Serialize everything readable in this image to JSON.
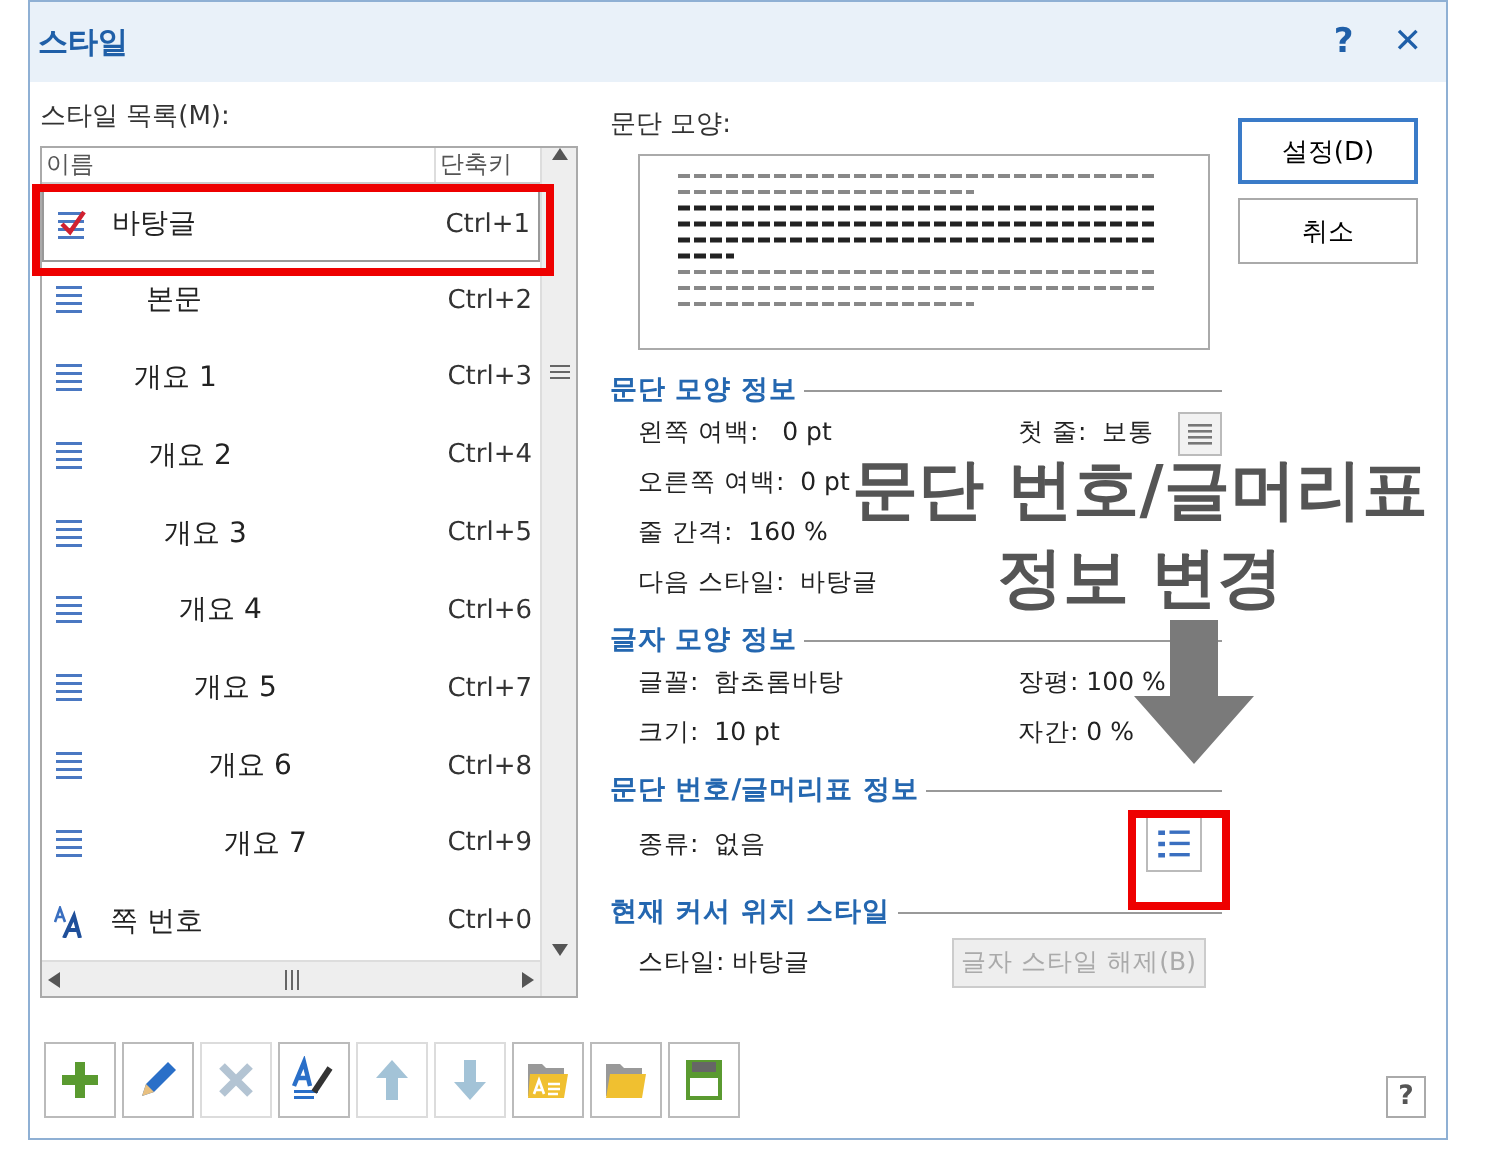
{
  "window": {
    "title": "스타일",
    "help": "?",
    "close": "✕"
  },
  "style_list": {
    "label": "스타일 목록(M):",
    "columns": [
      "이름",
      "단축키"
    ],
    "rows": [
      {
        "kind": "checked",
        "name": "바탕글",
        "shortcut": "Ctrl+1",
        "selected": true
      },
      {
        "kind": "paragraph",
        "name": "본문",
        "shortcut": "Ctrl+2",
        "selected": false
      },
      {
        "kind": "outline",
        "name": "개요 1",
        "shortcut": "Ctrl+3",
        "selected": false
      },
      {
        "kind": "outline",
        "name": "개요 2",
        "shortcut": "Ctrl+4",
        "selected": false
      },
      {
        "kind": "outline",
        "name": "개요 3",
        "shortcut": "Ctrl+5",
        "selected": false
      },
      {
        "kind": "outline",
        "name": "개요 4",
        "shortcut": "Ctrl+6",
        "selected": false
      },
      {
        "kind": "outline",
        "name": "개요 5",
        "shortcut": "Ctrl+7",
        "selected": false
      },
      {
        "kind": "outline",
        "name": "개요 6",
        "shortcut": "Ctrl+8",
        "selected": false
      },
      {
        "kind": "outline",
        "name": "개요 7",
        "shortcut": "Ctrl+9",
        "selected": false
      },
      {
        "kind": "character",
        "name": "쪽 번호",
        "shortcut": "Ctrl+0",
        "selected": false
      }
    ]
  },
  "preview": {
    "label": "문단 모양:"
  },
  "buttons": [
    "설정(D)",
    "취소"
  ],
  "paragraph_info": {
    "title": "문단 모양 정보",
    "left": [
      "왼쪽 여백:   0 pt",
      "오른쪽 여백:  0 pt",
      "줄 간격:  160 %",
      "다음 스타일:  바탕글"
    ],
    "right": [
      "첫 줄:  보통"
    ]
  },
  "char_info": {
    "title": "글자 모양 정보",
    "left": [
      "글꼴:  함초롬바탕",
      "크기:  10 pt"
    ],
    "right": [
      "장평: 100 %",
      "자간: 0 %"
    ]
  },
  "numbering_info": {
    "title": "문단 번호/글머리표 정보",
    "type": "종류:  없음"
  },
  "cursor_style": {
    "title": "현재 커서 위치 스타일",
    "style": "스타일: 바탕글",
    "clear_button": {
      "label": "글자 스타일 해제(B)",
      "disabled": true
    }
  },
  "toolbar": [
    {
      "kind": "add",
      "disabled": false
    },
    {
      "kind": "edit",
      "disabled": false
    },
    {
      "kind": "delete",
      "disabled": true
    },
    {
      "kind": "copy",
      "disabled": false
    },
    {
      "kind": "up",
      "disabled": true
    },
    {
      "kind": "down",
      "disabled": true
    },
    {
      "kind": "import",
      "disabled": false
    },
    {
      "kind": "open",
      "disabled": false
    },
    {
      "kind": "save",
      "disabled": false
    }
  ],
  "help_button": "?",
  "annotation": {
    "lines": [
      "문단 번호/글머리표",
      "정보 변경"
    ]
  }
}
